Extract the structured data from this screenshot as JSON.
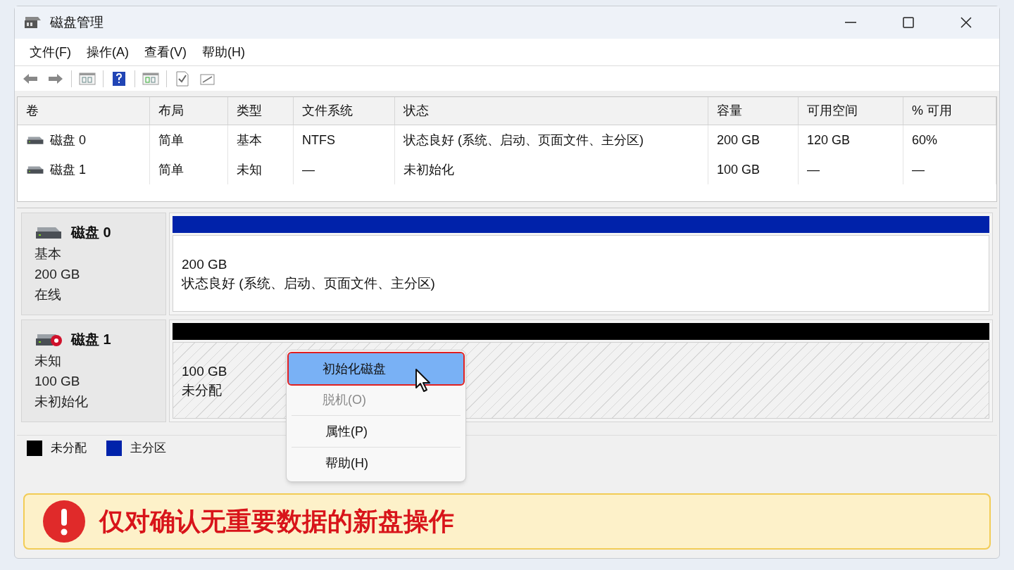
{
  "window": {
    "title": "磁盘管理"
  },
  "menu": [
    "文件(F)",
    "操作(A)",
    "查看(V)",
    "帮助(H)"
  ],
  "table": {
    "columns": [
      "卷",
      "布局",
      "类型",
      "文件系统",
      "状态",
      "容量",
      "可用空间",
      "% 可用"
    ],
    "rows": [
      [
        "磁盘 0",
        "简单",
        "基本",
        "NTFS",
        "状态良好 (系统、启动、页面文件、主分区)",
        "200 GB",
        "120 GB",
        "60%"
      ],
      [
        "磁盘 1",
        "简单",
        "未知",
        "—",
        "未初始化",
        "100 GB",
        "—",
        "—"
      ]
    ]
  },
  "disks": [
    {
      "name": "磁盘 0",
      "kind": "online",
      "type": "基本",
      "size": "200 GB",
      "status": "在线",
      "partition": {
        "kind": "primary",
        "color": "#0022aa",
        "size": "200 GB",
        "status": "状态良好 (系统、启动、页面文件、主分区)"
      }
    },
    {
      "name": "磁盘 1",
      "kind": "error",
      "type": "未知",
      "size": "100 GB",
      "status": "未初始化",
      "partition": {
        "kind": "unallocated",
        "color": "#000000",
        "size": "100 GB",
        "status": "未分配"
      }
    }
  ],
  "legend": [
    {
      "label": "未分配",
      "color": "#000000"
    },
    {
      "label": "主分区",
      "color": "#0022aa"
    }
  ],
  "context_menu": [
    {
      "label": "初始化磁盘",
      "selected": true,
      "disabled": false
    },
    {
      "label": "脱机(O)",
      "selected": false,
      "disabled": true
    },
    {
      "label": "属性(P)",
      "selected": false,
      "disabled": false
    },
    {
      "label": "帮助(H)",
      "selected": false,
      "disabled": false
    }
  ],
  "banner": {
    "text": "仅对确认无重要数据的新盘操作"
  }
}
